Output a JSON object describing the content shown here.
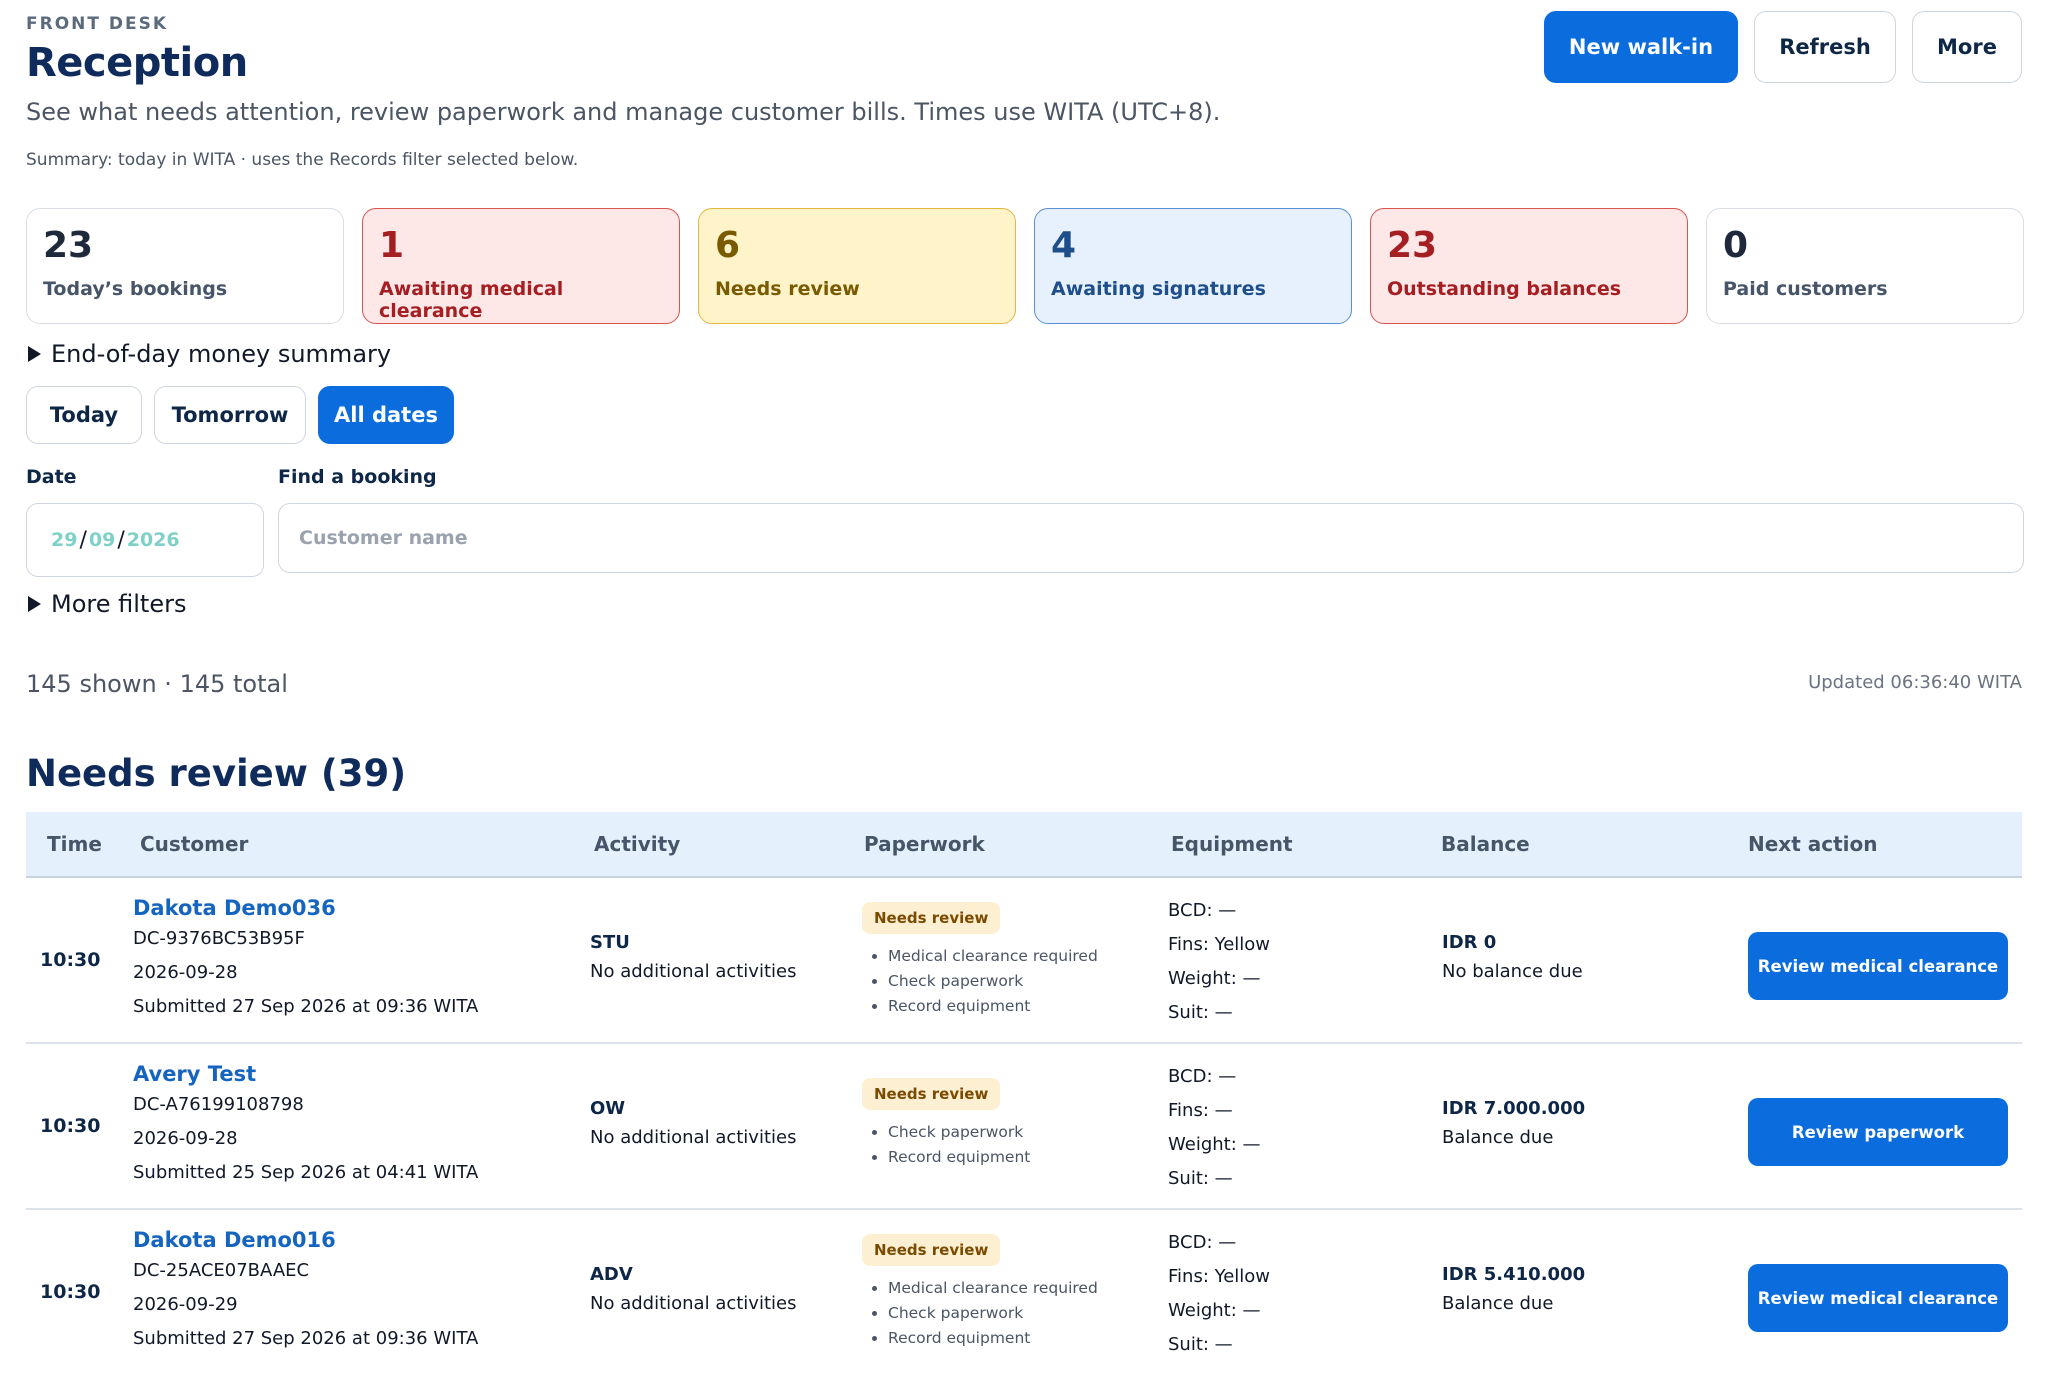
{
  "header": {
    "eyebrow": "FRONT DESK",
    "title": "Reception",
    "subtitle": "See what needs attention, review paperwork and manage customer bills. Times use WITA (UTC+8).",
    "summary_note": "Summary: today in WITA · uses the Records filter selected below.",
    "actions": {
      "new_walk_in": "New walk-in",
      "refresh": "Refresh",
      "more": "More"
    }
  },
  "stats": [
    {
      "value": "23",
      "label": "Today’s bookings",
      "tone": "neutral"
    },
    {
      "value": "1",
      "label": "Awaiting medical clearance",
      "tone": "red"
    },
    {
      "value": "6",
      "label": "Needs review",
      "tone": "yellow"
    },
    {
      "value": "4",
      "label": "Awaiting signatures",
      "tone": "blue"
    },
    {
      "value": "23",
      "label": "Outstanding balances",
      "tone": "red"
    },
    {
      "value": "0",
      "label": "Paid customers",
      "tone": "neutral"
    }
  ],
  "money_summary": {
    "label": "End-of-day money summary"
  },
  "range_tabs": {
    "today": "Today",
    "tomorrow": "Tomorrow",
    "all_dates": "All dates",
    "selected": "All dates"
  },
  "filters": {
    "date_label": "Date",
    "date_day": "29",
    "date_month": "09",
    "date_year": "2026",
    "find_label": "Find a booking",
    "find_placeholder": "Customer name",
    "find_value": "",
    "more_filters": "More filters"
  },
  "counts": {
    "text": "145 shown · 145 total",
    "updated": "Updated 06:36:40 WITA"
  },
  "section": {
    "title": "Needs review (39)"
  },
  "table": {
    "columns": [
      "Time",
      "Customer",
      "Activity",
      "Paperwork",
      "Equipment",
      "Balance",
      "Next action"
    ],
    "rows": [
      {
        "time": "10:30",
        "name": "Dakota Demo036",
        "ref": "DC-9376BC53B95F",
        "date": "2026-09-28",
        "submitted": "Submitted 27 Sep 2026 at 09:36 WITA",
        "activity": "STU",
        "activity_note": "No additional activities",
        "status": "Needs review",
        "tasks": [
          "Medical clearance required",
          "Check paperwork",
          "Record equipment"
        ],
        "bcd": "BCD: —",
        "fins": "Fins: Yellow",
        "weight": "Weight: —",
        "suit": "Suit: —",
        "amount": "IDR 0",
        "balance_note": "No balance due",
        "action": "Review medical clearance"
      },
      {
        "time": "10:30",
        "name": "Avery Test",
        "ref": "DC-A76199108798",
        "date": "2026-09-28",
        "submitted": "Submitted 25 Sep 2026 at 04:41 WITA",
        "activity": "OW",
        "activity_note": "No additional activities",
        "status": "Needs review",
        "tasks": [
          "Check paperwork",
          "Record equipment"
        ],
        "bcd": "BCD: —",
        "fins": "Fins: —",
        "weight": "Weight: —",
        "suit": "Suit: —",
        "amount": "IDR 7.000.000",
        "balance_note": "Balance due",
        "action": "Review paperwork"
      },
      {
        "time": "10:30",
        "name": "Dakota Demo016",
        "ref": "DC-25ACE07BAAEC",
        "date": "2026-09-29",
        "submitted": "Submitted 27 Sep 2026 at 09:36 WITA",
        "activity": "ADV",
        "activity_note": "No additional activities",
        "status": "Needs review",
        "tasks": [
          "Medical clearance required",
          "Check paperwork",
          "Record equipment"
        ],
        "bcd": "BCD: —",
        "fins": "Fins: Yellow",
        "weight": "Weight: —",
        "suit": "Suit: —",
        "amount": "IDR 5.410.000",
        "balance_note": "Balance due",
        "action": "Review medical clearance"
      }
    ]
  },
  "colors": {
    "primary": "#0b6cde",
    "title": "#0f2b5b",
    "link": "#1565c0",
    "header_row": "#e4f1fd",
    "red_bg": "#fde7e7",
    "yellow_bg": "#fff3c9",
    "blue_bg": "#e6f1fd"
  },
  "icons": {
    "disclosure": "disclosure-triangle-icon"
  }
}
